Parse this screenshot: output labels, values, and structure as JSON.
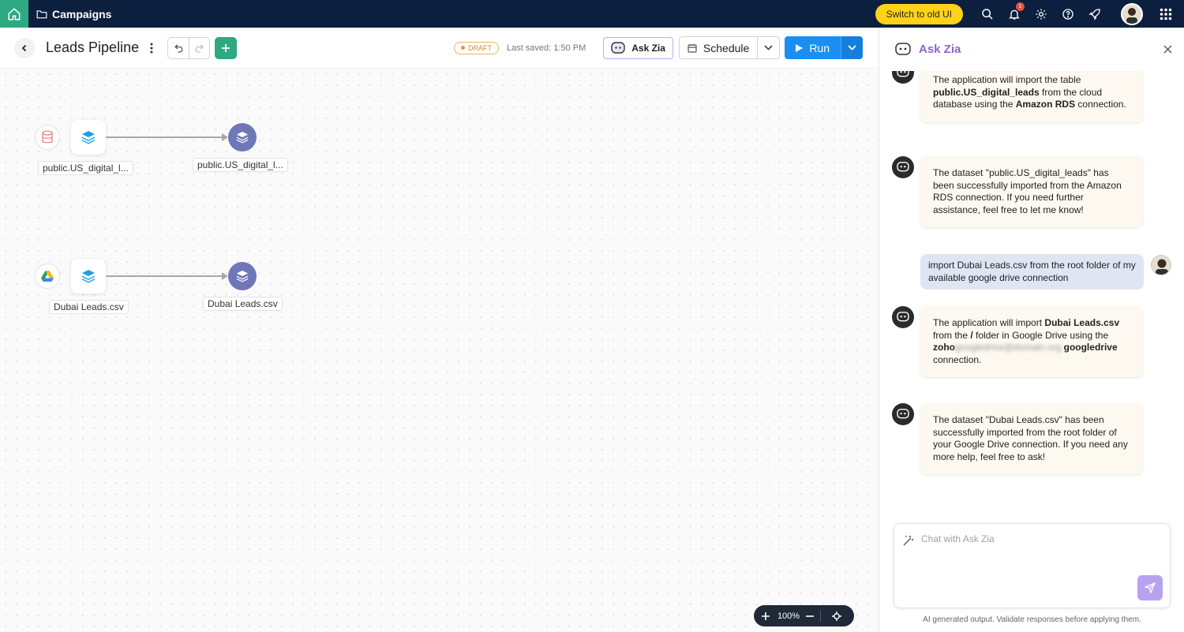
{
  "topnav": {
    "breadcrumb": "Campaigns",
    "switch_label": "Switch to old UI",
    "notification_count": "1"
  },
  "toolbar": {
    "title": "Leads Pipeline",
    "status": "DRAFT",
    "last_saved": "Last saved: 1:50 PM",
    "ask_zia_label": "Ask Zia",
    "schedule_label": "Schedule",
    "run_label": "Run"
  },
  "canvas": {
    "flows": [
      {
        "source_label": "public.US_digital_l...",
        "output_label": "public.US_digital_l...",
        "source_icon": "database-icon"
      },
      {
        "source_label": "Dubai Leads.csv",
        "output_label": "Dubai Leads.csv",
        "source_icon": "google-drive-icon"
      }
    ],
    "zoom": "100%"
  },
  "panel": {
    "title": "Ask Zia",
    "input_placeholder": "Chat with Ask Zia",
    "disclaimer": "AI generated output. Validate responses before applying them.",
    "messages": {
      "m1": {
        "p1": "The application will import the table ",
        "b1": "public.US_digital_leads",
        "p2": " from the cloud database using the ",
        "b2": "Amazon RDS",
        "p3": " connection."
      },
      "m2": "The dataset \"public.US_digital_leads\" has been successfully imported from the Amazon RDS connection. If you need further assistance, feel free to let me know!",
      "m3": "import Dubai Leads.csv from the root folder of my available google drive connection",
      "m4": {
        "p1": "The application will import ",
        "b1": "Dubai Leads.csv",
        "p2": " from the ",
        "b2": "/",
        "p3": " folder in Google Drive using the ",
        "b3": "zoho",
        "blurred": "googledrive@domain.org",
        "b4": "googledrive",
        "p4": " connection."
      },
      "m5": "The dataset \"Dubai Leads.csv\" has been successfully imported from the root folder of your Google Drive connection. If you need any more help, feel free to ask!"
    }
  },
  "colors": {
    "nav_bg": "#0c1f3f",
    "accent_green": "#2fa982",
    "run_blue": "#1a8ff1",
    "zia_purple": "#8f64c8",
    "output_node": "#7077b8"
  }
}
